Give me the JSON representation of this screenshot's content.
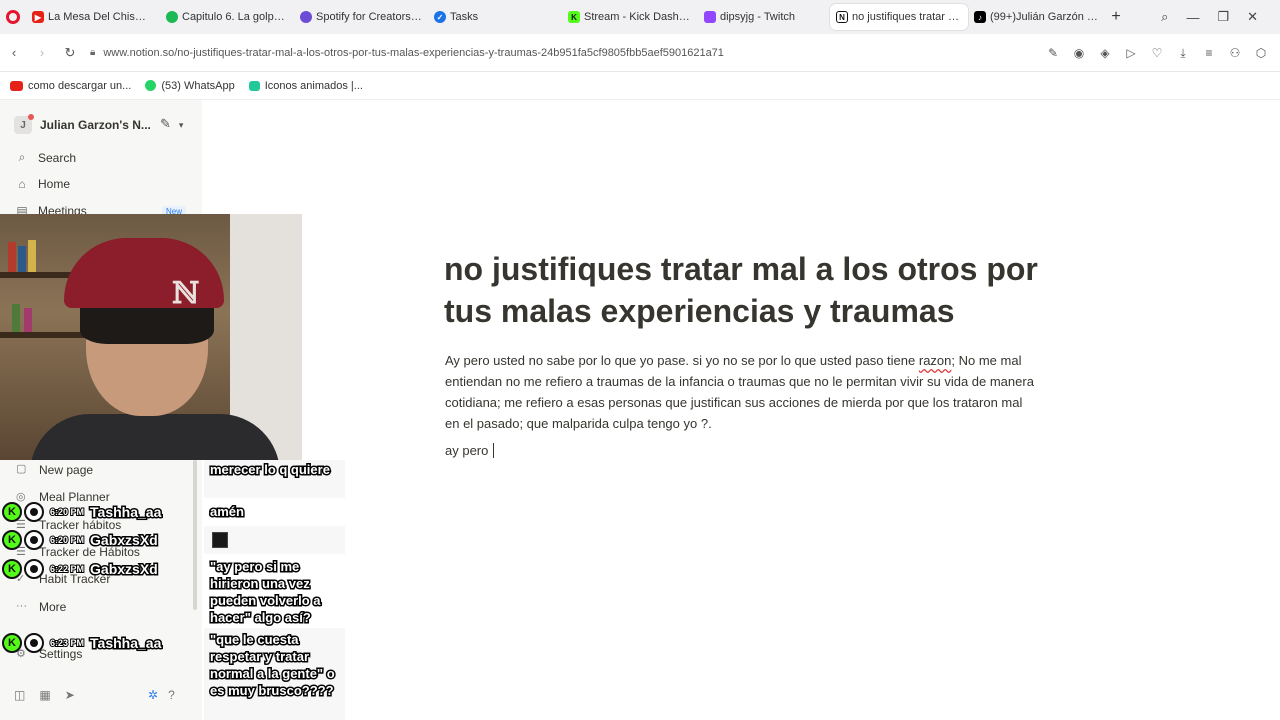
{
  "browser": {
    "tabs": [
      {
        "title": "La Mesa Del Chisme - Yo",
        "color": "#e62117",
        "active": false
      },
      {
        "title": "Capitulo 6. La golpeó ha",
        "color": "#1db954",
        "active": false
      },
      {
        "title": "Spotify for Creators: la fo",
        "color": "#6c4bd6",
        "active": false
      },
      {
        "title": "Tasks",
        "color": "#1a73e8",
        "active": false
      },
      {
        "title": "Stream - Kick Dashboard",
        "color": "#53fc18",
        "active": false
      },
      {
        "title": "dipsyjg - Twitch",
        "color": "#9146ff",
        "active": false
      },
      {
        "title": "no justifiques tratar mal a",
        "color": "#111111",
        "active": true
      },
      {
        "title": "(99+)Julián Garzón (@dip",
        "color": "#000000",
        "active": false
      }
    ],
    "url": "www.notion.so/no-justifiques-tratar-mal-a-los-otros-por-tus-malas-experiencias-y-traumas-24b951fa5cf9805fbb5aef5901621a71",
    "bookmarks": [
      {
        "label": "como descargar un...",
        "color": "#e62117"
      },
      {
        "label": "(53) WhatsApp",
        "color": "#25d366"
      },
      {
        "label": "Iconos animados |...",
        "color": "#20c997"
      }
    ]
  },
  "sidebar": {
    "workspace": "Julian Garzon's N...",
    "workspace_initial": "J",
    "items": [
      {
        "label": "Search",
        "icon": "search-icon"
      },
      {
        "label": "Home",
        "icon": "home-icon"
      },
      {
        "label": "Meetings",
        "icon": "meetings-icon"
      }
    ],
    "new_badge": "New",
    "lower_items": [
      {
        "label": "New page"
      },
      {
        "label": "Meal Planner"
      },
      {
        "label": "Tracker hábitos"
      },
      {
        "label": "Tracker de Hábitos"
      },
      {
        "label": "Habit Tracker"
      },
      {
        "label": "More"
      },
      {
        "label": "Settings"
      }
    ]
  },
  "page": {
    "title": "no justifiques tratar mal a los otros por tus malas experiencias y traumas",
    "body_before": "Ay pero usted no sabe por lo que yo pase. si yo no se por lo que usted paso tiene ",
    "body_spell": "razon",
    "body_after": "; No me mal entiendan no me refiero a traumas de la infancia o traumas que no le permitan vivir su vida de manera cotidiana; me refiero a esas personas que justifican sus acciones de mierda por que los trataron mal en el pasado; que malparida culpa tengo yo ?.",
    "line2": "ay pero"
  },
  "chat": {
    "messages": [
      {
        "text": "merecer lo q quiere"
      },
      {
        "time": "6:20 PM",
        "user": "Tashha_aa",
        "text": "amén"
      },
      {
        "time": "6:20 PM",
        "user": "GabxzsXd",
        "text": ""
      },
      {
        "time": "6:22 PM",
        "user": "GabxzsXd",
        "text": "\"ay pero si me hirieron una vez pueden volverlo a hacer\" algo así?"
      },
      {
        "time": "6:23 PM",
        "user": "Tashha_aa",
        "text": "\"que le cuesta respetar y tratar normal a la gente\" o es muy brusco????"
      }
    ]
  }
}
